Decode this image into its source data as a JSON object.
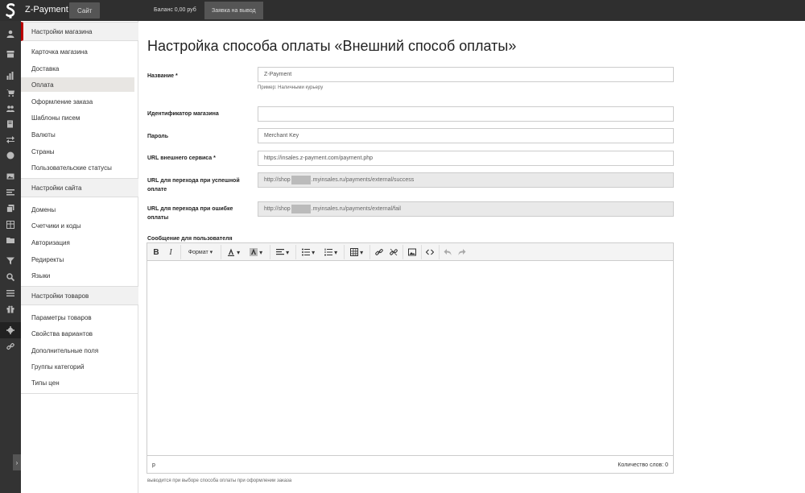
{
  "topbar": {
    "shop_name": "Z-Payment",
    "site_label": "Сайт",
    "balance": "Баланс 0,00 руб",
    "withdraw_label": "Заявка на вывод"
  },
  "rail": {
    "icons": [
      "user-icon",
      "storefront-icon",
      "chart-icon",
      "cart-icon",
      "users-icon",
      "documents-icon",
      "transfer-icon",
      "palette-icon",
      "image-icon",
      "list-icon",
      "pages-icon",
      "table-icon",
      "folder-icon",
      "filter-icon",
      "search-icon",
      "menu-icon",
      "gift-icon",
      "gear-icon",
      "link-icon"
    ],
    "toggle": "›"
  },
  "sidebar": {
    "store_section": "Настройки магазина",
    "store_items": [
      "Карточка магазина",
      "Доставка",
      "Оплата",
      "Оформление заказа",
      "Шаблоны писем",
      "Валюты",
      "Страны",
      "Пользовательские статусы"
    ],
    "site_section": "Настройки сайта",
    "site_items": [
      "Домены",
      "Счетчики и коды",
      "Авторизация",
      "Редиректы",
      "Языки"
    ],
    "goods_section": "Настройки товаров",
    "goods_items": [
      "Параметры товаров",
      "Свойства вариантов",
      "Дополнительные поля",
      "Группы категорий",
      "Типы цен"
    ]
  },
  "page": {
    "title": "Настройка способа оплаты «Внешний способ оплаты»"
  },
  "form": {
    "name_label": "Название *",
    "name_value": "Z-Payment",
    "name_hint": "Пример: Наличными курьеру",
    "shop_id_label": "Идентификатор магазина",
    "shop_id_value": "",
    "password_label": "Пароль",
    "password_value": "Merchant Key",
    "service_url_label": "URL внешнего сервиса *",
    "service_url_value": "https://insales.z-payment.com/payment.php",
    "success_url_label": "URL для перехода при успешной оплате",
    "success_url_prefix": "http://shop",
    "success_url_suffix": ".myinsales.ru/payments/external/success",
    "fail_url_label": "URL для перехода при ошибке оплаты",
    "fail_url_prefix": "http://shop",
    "fail_url_suffix": ".myinsales.ru/payments/external/fail",
    "message_label": "Сообщение для пользователя",
    "message_hint": "выводится при выборе способа оплаты при оформлении заказа"
  },
  "editor": {
    "bold": "B",
    "italic": "I",
    "format": "Формат",
    "path": "p",
    "word_count": "Количество слов: 0",
    "content": ""
  }
}
